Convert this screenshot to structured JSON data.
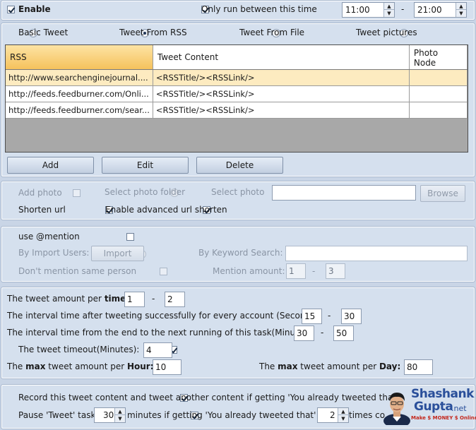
{
  "top": {
    "enable_label": "Enable",
    "only_run_label": "Only run between this time",
    "start_time": "11:00",
    "dash": "-",
    "end_time": "21:00"
  },
  "tweet_source": {
    "options": [
      "Basic Tweet",
      "Tweet From RSS",
      "Tweet From File",
      "Tweet pictures"
    ],
    "selected": "Tweet From RSS"
  },
  "rss_table": {
    "columns": [
      "RSS",
      "Tweet Content",
      "Photo Node"
    ],
    "rows": [
      {
        "rss": "http://www.searchenginejournal....",
        "content": "<RSSTitle/><RSSLink/>",
        "photo": ""
      },
      {
        "rss": "http://feeds.feedburner.com/Onli...",
        "content": "<RSSTitle/><RSSLink/>",
        "photo": ""
      },
      {
        "rss": "http://feeds.feedburner.com/sear...",
        "content": "<RSSTitle/><RSSLink/>",
        "photo": ""
      }
    ],
    "buttons": {
      "add": "Add",
      "edit": "Edit",
      "delete": "Delete"
    }
  },
  "photo": {
    "add_photo": "Add photo",
    "select_folder": "Select photo folder",
    "select_photo": "Select photo",
    "browse": "Browse",
    "shorten_url": "Shorten url",
    "advanced_shorten": "Enable advanced url shorten"
  },
  "mention": {
    "use_mention": "use @mention",
    "by_import": "By Import Users:",
    "import_btn": "Import",
    "by_keyword": "By Keyword Search:",
    "dont_mention_same": "Don't mention same person",
    "mention_amount_label": "Mention amount:",
    "amount_min": "1",
    "amount_max": "3"
  },
  "timing": {
    "amount_per_time_label": "The tweet amount per ",
    "amount_per_time_bold": "time:",
    "amount_min": "1",
    "amount_max": "2",
    "interval_success_label": "The interval time after tweeting successfully for every account (Seconds):",
    "interval_success_min": "15",
    "interval_success_max": "30",
    "interval_next_label": "The interval time from the end to the next running of this task(Minutes):",
    "interval_next_min": "30",
    "interval_next_max": "50",
    "timeout_label": "The tweet timeout(Minutes):",
    "timeout_value": "4",
    "max_hour_pre": "The ",
    "max_hour_bold": "max",
    "max_hour_mid": " tweet amount per ",
    "max_hour_bold2": "Hour:",
    "max_hour_value": "10",
    "max_day_pre": "The ",
    "max_day_bold": "max",
    "max_day_mid": " tweet amount per ",
    "max_day_bold2": "Day:",
    "max_day_value": "80"
  },
  "bottom": {
    "record_label": "Record this tweet content and tweet another content if getting 'You already tweeted that'.",
    "pause_label": "Pause 'Tweet' task",
    "pause_value": "30",
    "pause_mid": "minutes if getting 'You already tweeted that' for",
    "pause_times": "2",
    "pause_end": "times co"
  },
  "watermark": {
    "line1": "Shashank",
    "line2": "Gupta",
    "suffix": ".net",
    "tagline": "Make $ MONEY $ Online"
  }
}
